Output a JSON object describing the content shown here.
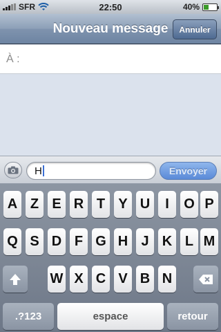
{
  "status_bar": {
    "carrier": "SFR",
    "time": "22:50",
    "battery": "40%",
    "battery_level": 0.4,
    "signal_icon": "signal-bars-icon",
    "wifi_icon": "wifi-icon"
  },
  "nav": {
    "title": "Nouveau message",
    "cancel_label": "Annuler"
  },
  "to_field": {
    "label": "À :"
  },
  "compose": {
    "camera_icon": "camera-icon",
    "input_value": "H",
    "send_label": "Envoyer"
  },
  "keyboard": {
    "row1": [
      "A",
      "Z",
      "E",
      "R",
      "T",
      "Y",
      "U",
      "I",
      "O",
      "P"
    ],
    "row2": [
      "Q",
      "S",
      "D",
      "F",
      "G",
      "H",
      "J",
      "K",
      "L",
      "M"
    ],
    "row3": [
      "W",
      "X",
      "C",
      "V",
      "B",
      "N"
    ],
    "numbers_label": ".?123",
    "space_label": "espace",
    "return_label": "retour",
    "shift_icon": "shift-arrow-icon",
    "delete_icon": "backspace-icon"
  }
}
